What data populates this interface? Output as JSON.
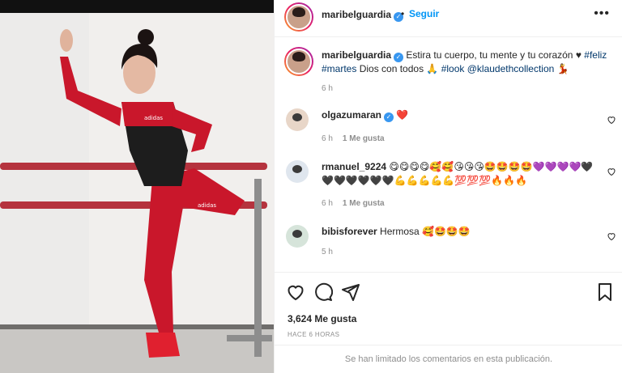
{
  "post": {
    "username": "maribelguardia",
    "follow_label": "Seguir",
    "dot": "•",
    "more": "•••"
  },
  "caption": {
    "username": "maribelguardia",
    "text": "Estira tu cuerpo, tu mente y tu corazón ♥ ",
    "hashtag1": "#feliz",
    "hashtag2": "#martes",
    "mid": " Dios con todos 🙏 ",
    "hashtag3": "#look",
    "mention": "@klaudethcollection",
    "end": " 💃",
    "time": "6 h"
  },
  "comments": [
    {
      "username": "olgazumaran",
      "text": " ❤️",
      "time": "6 h",
      "likes": "1 Me gusta"
    },
    {
      "username": "rmanuel_9224",
      "text": " 😋😋😋😋🥰🥰😘😘😘🤩🤩🤩🤩💜💜💜💜🖤🖤🖤🖤🖤🖤🖤💪💪💪💪💪💯💯💯🔥🔥🔥",
      "time": "6 h",
      "likes": "1 Me gusta"
    },
    {
      "username": "bibisforever",
      "text": " Hermosa 🥰🤩🤩🤩",
      "time": "5 h",
      "likes": ""
    }
  ],
  "actions": {
    "likes": "3,624 Me gusta",
    "posted": "HACE 6 HORAS",
    "limited": "Se han limitado los comentarios en esta publicación."
  },
  "colors": {
    "accent": "#0095f6",
    "verified": "#3897f0",
    "link": "#00376b",
    "muted": "#8e8e8e"
  }
}
